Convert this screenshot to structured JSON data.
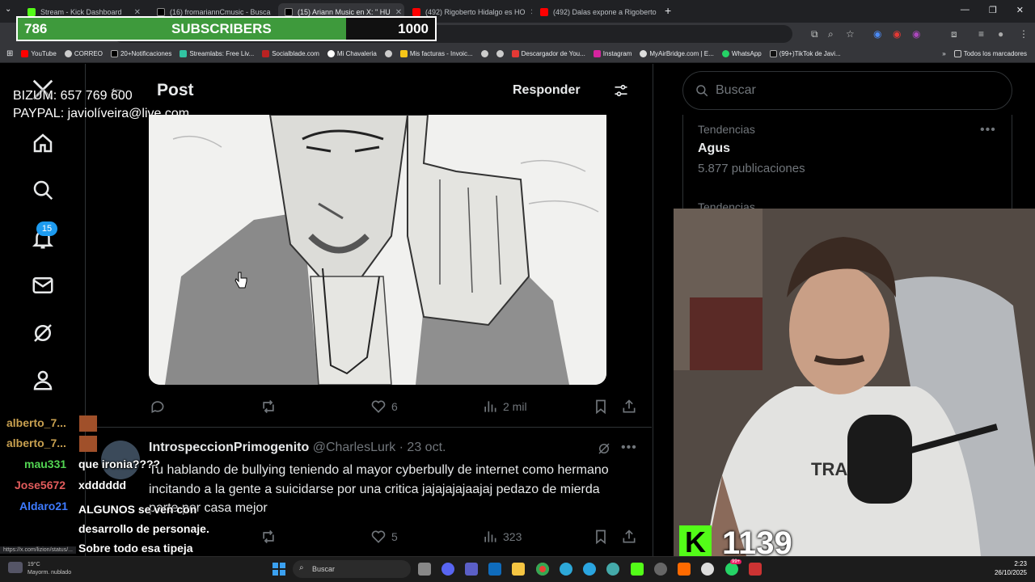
{
  "browser": {
    "tabs": [
      {
        "label": "Stream - Kick Dashboard",
        "color": "#53fc18",
        "active": false
      },
      {
        "label": "(16) fromariannCmusic - Busca",
        "color": "#000000",
        "active": false
      },
      {
        "label": "(15) Ariann Music en X: \" HU",
        "color": "#000000",
        "active": true
      },
      {
        "label": "(492) Rigoberto Hidalgo es HO",
        "color": "#ff0000",
        "active": false
      },
      {
        "label": "(492) Dalas expone a Rigoberto",
        "color": "#ff0000",
        "active": false
      }
    ],
    "bookmarks": [
      "YouTube",
      "CORREO",
      "20+Notificaciones",
      "Streamlabs: Free Liv...",
      "Socialblade.com",
      "Mi Chavaleria",
      "",
      "Mis facturas - Invoic...",
      "",
      "",
      "Descargador de You...",
      "Instagram",
      "MyAirBridge.com | E...",
      "WhatsApp",
      "(99+)TikTok de Javi..."
    ],
    "bookmarks_folder": "Todos los marcadores",
    "status_url": "https://x.com/lizion/status/..."
  },
  "overlay": {
    "subs_current": "786",
    "subs_label": "SUBSCRIBERS",
    "subs_goal": "1000",
    "subs_progress": 0.786,
    "donate_line1": "BIZUM: 657 769 600",
    "donate_line2": "PAYPAL: javiolíveira@live.com",
    "kick_letter": "K",
    "kick_count": "1139"
  },
  "x": {
    "header_title": "Post",
    "reply_button": "Responder",
    "notif_badge": "15",
    "post_actions": {
      "likes": "6",
      "views": "2 mil"
    },
    "reply": {
      "name": "IntrospeccionPrimogenito",
      "handle": "@CharlesLurk · 23 oct.",
      "text": "Tu hablando de bullying teniendo al mayor cyberbully de internet como hermano incitando a la gente a suicidarse por una critica jajajajajaajaj pedazo de mierda parte por casa mejor",
      "likes": "5",
      "views": "323"
    },
    "search_placeholder": "Buscar",
    "trends": {
      "label": "Tendencias",
      "name": "Agus",
      "count": "5.877 publicaciones",
      "label2": "Tendencias"
    }
  },
  "chat": [
    {
      "user": "alberto_7...",
      "msg": "",
      "color": "#c8a050"
    },
    {
      "user": "alberto_7...",
      "msg": "",
      "color": "#c8a050"
    },
    {
      "user": "mau331",
      "msg": "que ironia????",
      "color": "#52d452"
    },
    {
      "user": "Jose5672",
      "msg": "xdddddd",
      "color": "#e25c5c"
    },
    {
      "user": "Aldaro21",
      "msg": "ALGUNOS se ven con desarrollo de personaje. Sobre todo esa tipeja jajajajjja",
      "color": "#3e7bff"
    }
  ],
  "taskbar": {
    "search": "Buscar",
    "weather_temp": "19°C",
    "weather_desc": "Mayorm. nublado",
    "time": "2:23",
    "date": "26/10/2025",
    "badge": "99+"
  }
}
